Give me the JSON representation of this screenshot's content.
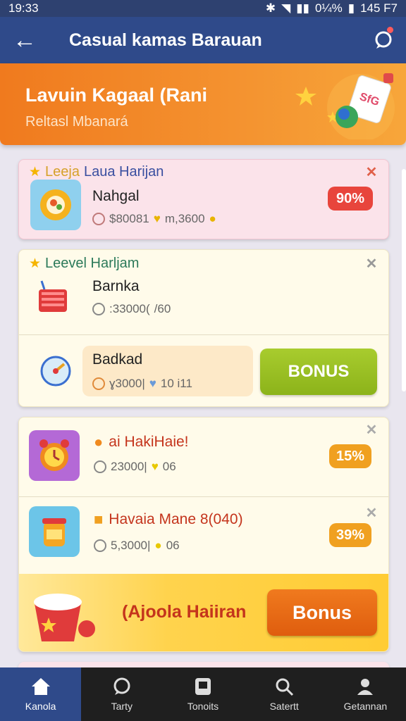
{
  "status": {
    "time": "19:33",
    "battery": "0¼%",
    "temp": "145 F7"
  },
  "appbar": {
    "title": "Casual kamas Barauan"
  },
  "banner": {
    "title": "Lavuin Kagaal (Rani",
    "subtitle": "Reltasl Mbanará",
    "art_label": "SfG"
  },
  "card1": {
    "header_a": "Leeja",
    "header_b": "Laua Harijan",
    "app_name": "Nahgal",
    "stat_a": "$80081",
    "stat_b": "m,3600",
    "percent": "90%",
    "colors": {
      "percent_bg": "#e8453c",
      "close": "#e0604a"
    }
  },
  "card2": {
    "header": "Leevel Harljam",
    "item1": {
      "name": "Barnka",
      "stat_a": ":33000(",
      "stat_b": "/60"
    },
    "item2": {
      "name": "Badkad",
      "stat_a": "ɣ3000|",
      "stat_b": "10 i11"
    },
    "bonus_label": "BONUS",
    "colors": {
      "bonus": "#99be24"
    }
  },
  "card3": {
    "item1": {
      "name": "ai HakiHaie!",
      "stat_a": "23000|",
      "stat_b": "06",
      "percent": "15%"
    },
    "item2": {
      "name": "Havaia Mane 8(040)",
      "stat_a": "5,3000|",
      "stat_b": "06",
      "percent": "39%"
    },
    "promo_text": "(Ajoola Haiiran",
    "bonus_label": "Bonus",
    "colors": {
      "percent_bg": "#f0a020",
      "name": "#c4341c"
    }
  },
  "nav": [
    {
      "label": "Kanola",
      "icon": "home-icon"
    },
    {
      "label": "Tarty",
      "icon": "chat-icon"
    },
    {
      "label": "Tonoits",
      "icon": "tablet-icon"
    },
    {
      "label": "Satertt",
      "icon": "search-icon"
    },
    {
      "label": "Getannan",
      "icon": "profile-icon"
    }
  ]
}
